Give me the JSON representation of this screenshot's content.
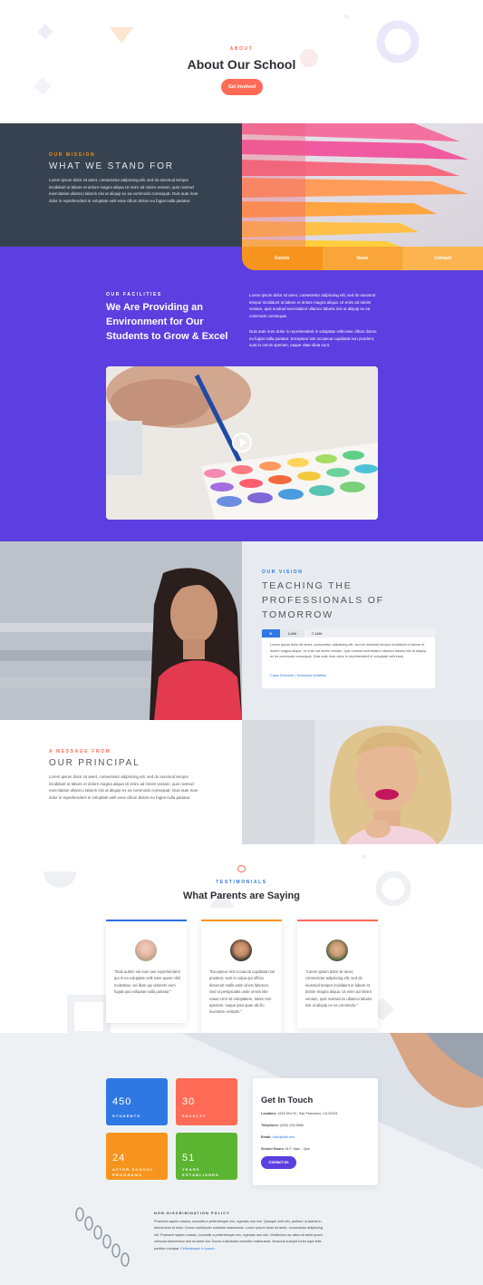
{
  "hero": {
    "eyebrow": "ABOUT",
    "title": "About Our School",
    "button": "Get Involved"
  },
  "mission": {
    "eyebrow": "OUR MISSION",
    "title": "WHAT WE STAND FOR",
    "body": "Lorem ipsum dolor sit amet, consectetur adipiscing elit, sed do eiusmod tempor incididunt ut labore et dolore magna aliqua Ut enim ad minim veniam, quis nostrud exercitation ullamco laboris nisi ut aliquip ex ea commodo consequat. Duis aute irure dolor in reprehenderit in voluptate velit esse cillum dolore eu fugiat nulla pariatur.",
    "tabs": [
      "Events",
      "News",
      "Contact"
    ],
    "tab_colors": [
      "#f7941d",
      "#f9a53a",
      "#fbb450"
    ]
  },
  "facilities": {
    "eyebrow": "OUR FACILITIES",
    "title_lines": [
      "We Are Providing an",
      "Environment for Our",
      "Students to Grow & Excel"
    ],
    "body1": "Lorem ipsum dolor sit amet, consectetur adipiscing elit, sed do eiusmod tempor incididunt ut labore et dolore magna aliqua. Ut enim ad minim veniam, quis nostrud exercitation ullamco laboris nisi ut aliquip ex ea commodo consequat.",
    "body2": "Duis aute irure dolor in reprehenderit in voluptate velit esse cillum dolore eu fugiat nulla pariatur. Excepteur sint occaecat cupidatat non proident, sunt in omnis sperium, eaque vitae dicta sunt."
  },
  "vision": {
    "eyebrow": "OUR VISION",
    "title_lines": [
      "TEACHING THE",
      "PROFESSIONALS OF",
      "TOMORROW"
    ],
    "tabs": [
      "K",
      "1-6th",
      "7-12th"
    ],
    "body": "Lorem ipsum dolor sit amet, consectetur adipiscing elit, sed do eiusmod tempor incididunt ut labore et dolore magna aliqua. Ut enim ad minim veniam, quis nostrud exercitation ullamco laboris nisi ut aliquip ex ea commodo consequat. Duis aute irure dolor in reprehenderit in voluptate velit esse.",
    "link": "Class Schedule | Download Activities"
  },
  "principal": {
    "eyebrow": "A MESSAGE FROM",
    "title": "OUR PRINCIPAL",
    "body": "Lorem ipsum dolor sit amet, consectetur adipiscing elit, sed do eiusmod tempor incididunt ut labore et dolore magna aliqua Ut enim ad minim veniam, quis nostrud exercitation ullamco laboris nisi ut aliquip ex ea commodo consequat. Duis aute irure dolor in reprehenderit in voluptate velit esse cillum dolore eu fugiat nulla pariatur."
  },
  "testimonials": {
    "eyebrow": "TESTIMONIALS",
    "title": "What Parents are Saying",
    "cards": [
      {
        "text": "\"Duis autem vel eum iure reprehenderit qui in ea voluptate velit esse quam nihil molestiae, vel illum qui dolorem eum fugiat quo voluptas nulla pariatur.\"",
        "color": "#2f6fde"
      },
      {
        "text": "\"Excepteur sint occaecat cupidatat non proident, sunt in culpa qui officia deserunt mollit anim id est laborum. Sed ut perspiciatis unde omnis iste natus error sit voluptatem, totam rem aperiam, eaque ipsa quae ab illo inventore veritatis.\"",
        "color": "#f7941d"
      },
      {
        "text": "\"Lorem ipsum dolor sit amet, consectetur adipiscing elit, sed do eiusmod tempor incididunt ut labore et dolore magna aliqua. Ut enim ad minim veniam, quis nostrud ex ullamco laboris nisi ut aliquip ex ea commodo.\"",
        "color": "#ff6b57"
      }
    ]
  },
  "stats": [
    {
      "num": "450",
      "label": "STUDENTS",
      "color": "#2f78e3"
    },
    {
      "num": "30",
      "label": "FACULTY",
      "color": "#ff6b57"
    },
    {
      "num": "24",
      "label": "AFTER SCHOOL PROGRAMS",
      "color": "#f7941d"
    },
    {
      "num": "51",
      "label": "YEARS ESTABLISHED",
      "color": "#5cb531"
    }
  ],
  "contact": {
    "title": "Get In Touch",
    "location_label": "Location:",
    "location": "1245 Divi St., San Francisco, CA 92421",
    "phone_label": "Telephone:",
    "phone": "(435) 123-5566",
    "email_label": "Email:",
    "email": "hello@divi.edu",
    "hours_label": "School Hours:",
    "hours": "M-F: 8am - 3pm",
    "button": "Contact Us"
  },
  "policy": {
    "title": "NON-DISCRIMINATION POLICY",
    "body": "Praesent sapien massa, convallis a pellentesque nec, egestas non nisi. Quisque velit nisi, pretium ut lacinia in, elementum id enim. Donec sollicitudin molestie malesuada. Lorem ipsum dolor sit amet, consectetur adipiscing elit. Praesent sapien massa, convallis a pellentesque nec, egestas non nisi. Vestibulum ac diam sit amet quam vehicula elementum sed sit amet dui. Donec sollicitudin molestie malesuada. Vivamus suscipit tortor eget felis porttitor volutpat.",
    "link": "Pellentesque in ipsum."
  },
  "colors": {
    "accent_orange": "#ff6b57",
    "purple": "#5b3fe0",
    "blue": "#2f78e3",
    "dark": "#36424f"
  }
}
